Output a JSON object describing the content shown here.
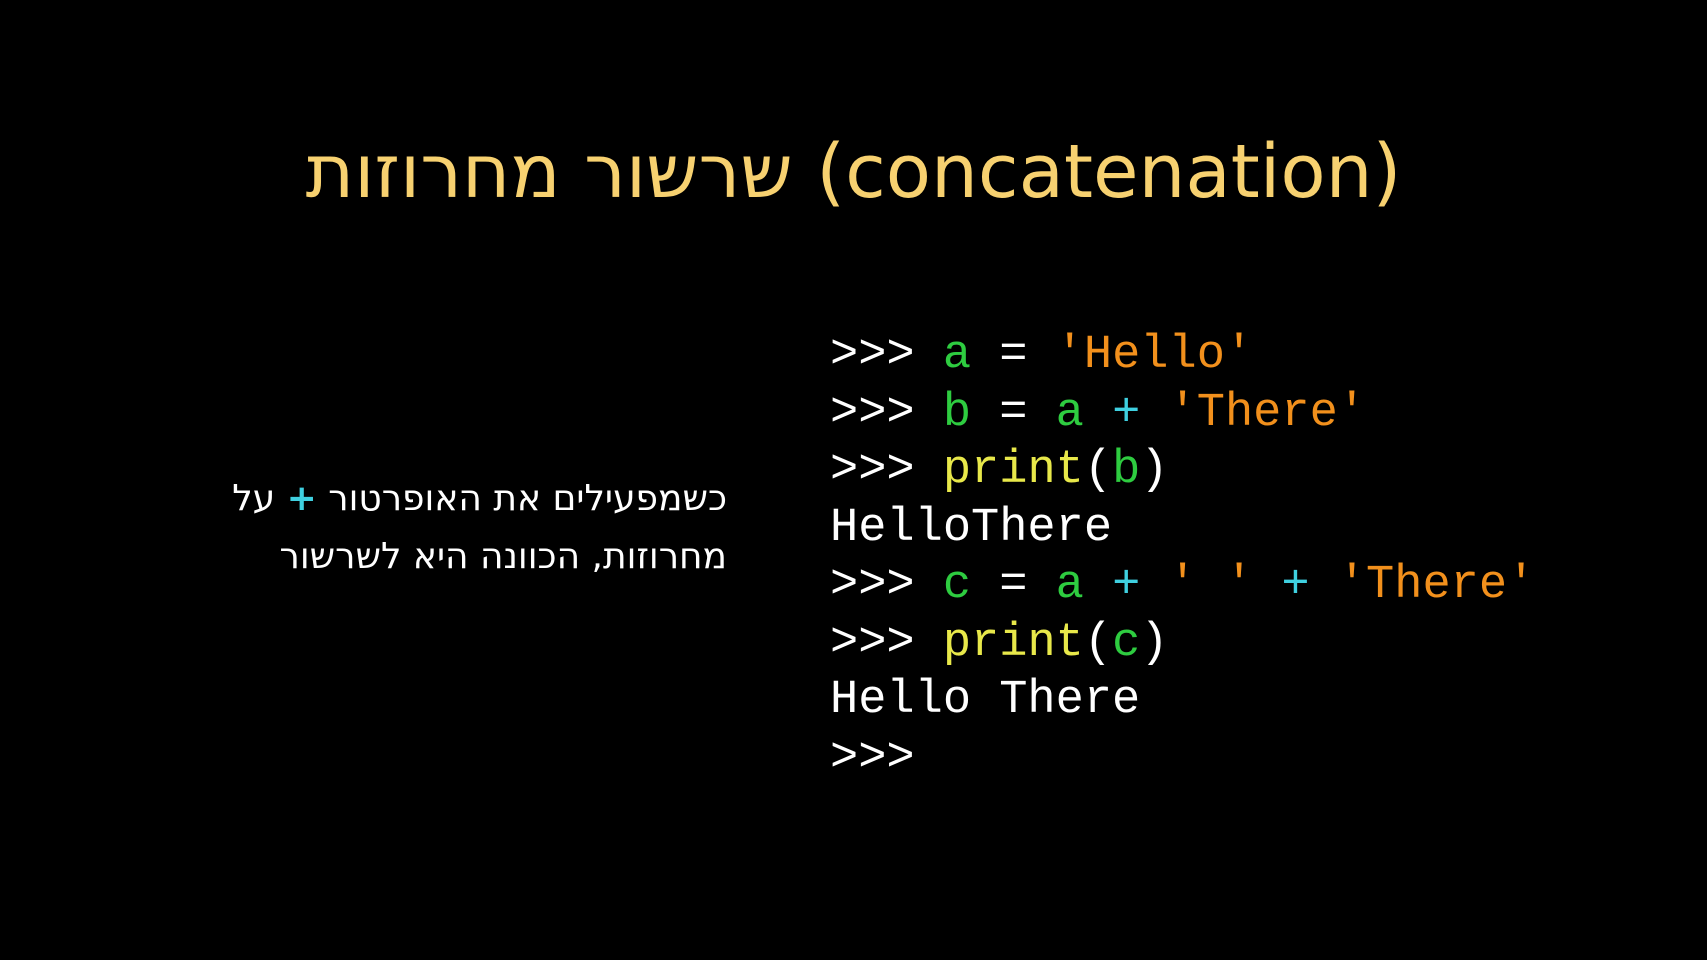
{
  "colors": {
    "background": "#000000",
    "title": "#F7D170",
    "text": "#FFFFFF",
    "plus": "#3FD0E0",
    "prompt": "#FFFFFF",
    "variable": "#2ECC40",
    "string": "#F2901C",
    "function": "#E8E84A",
    "operator": "#3FD0E0",
    "output": "#FFFFFF"
  },
  "title": "שרשור מחרוזות (concatenation)",
  "description": {
    "line1_before": "כשמפעילים את האופרטור ",
    "plus": "+",
    "line1_after": " על",
    "line2": "מחרוזות, הכוונה היא לשרשור"
  },
  "code_lines": [
    [
      {
        "t": ">>> ",
        "k": "prompt"
      },
      {
        "t": "a",
        "k": "variable"
      },
      {
        "t": " = ",
        "k": "prompt"
      },
      {
        "t": "'Hello'",
        "k": "string"
      }
    ],
    [
      {
        "t": ">>> ",
        "k": "prompt"
      },
      {
        "t": "b",
        "k": "variable"
      },
      {
        "t": " = ",
        "k": "prompt"
      },
      {
        "t": "a",
        "k": "variable"
      },
      {
        "t": " ",
        "k": "prompt"
      },
      {
        "t": "+",
        "k": "operator"
      },
      {
        "t": " ",
        "k": "prompt"
      },
      {
        "t": "'There'",
        "k": "string"
      }
    ],
    [
      {
        "t": ">>> ",
        "k": "prompt"
      },
      {
        "t": "print",
        "k": "function"
      },
      {
        "t": "(",
        "k": "prompt"
      },
      {
        "t": "b",
        "k": "variable"
      },
      {
        "t": ")",
        "k": "prompt"
      }
    ],
    [
      {
        "t": "HelloThere",
        "k": "output"
      }
    ],
    [
      {
        "t": ">>> ",
        "k": "prompt"
      },
      {
        "t": "c",
        "k": "variable"
      },
      {
        "t": " = ",
        "k": "prompt"
      },
      {
        "t": "a",
        "k": "variable"
      },
      {
        "t": " ",
        "k": "prompt"
      },
      {
        "t": "+",
        "k": "operator"
      },
      {
        "t": " ",
        "k": "prompt"
      },
      {
        "t": "' '",
        "k": "string"
      },
      {
        "t": " ",
        "k": "prompt"
      },
      {
        "t": "+",
        "k": "operator"
      },
      {
        "t": " ",
        "k": "prompt"
      },
      {
        "t": "'There'",
        "k": "string"
      }
    ],
    [
      {
        "t": ">>> ",
        "k": "prompt"
      },
      {
        "t": "print",
        "k": "function"
      },
      {
        "t": "(",
        "k": "prompt"
      },
      {
        "t": "c",
        "k": "variable"
      },
      {
        "t": ")",
        "k": "prompt"
      }
    ],
    [
      {
        "t": "Hello There",
        "k": "output"
      }
    ],
    [
      {
        "t": ">>>",
        "k": "prompt"
      }
    ]
  ]
}
